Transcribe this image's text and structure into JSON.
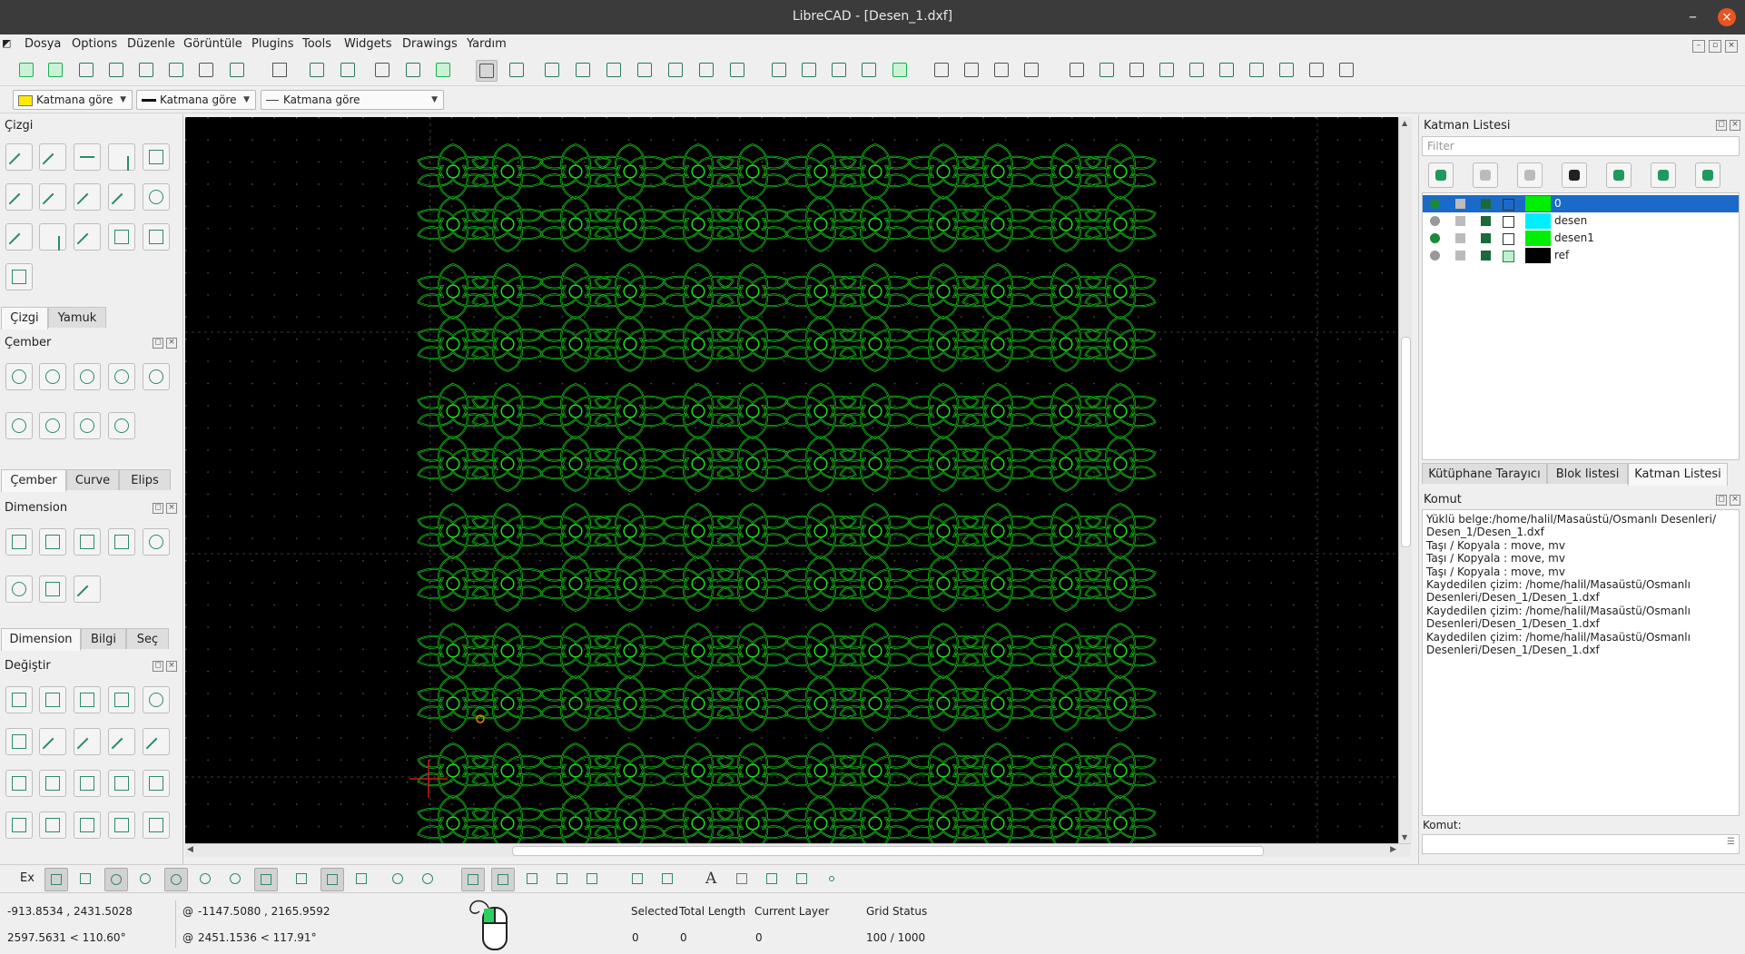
{
  "window": {
    "title": "LibreCAD - [Desen_1.dxf]"
  },
  "menu": [
    "Dosya",
    "Options",
    "Düzenle",
    "Görüntüle",
    "Plugins",
    "Tools",
    "Widgets",
    "Drawings",
    "Yardım"
  ],
  "properties": {
    "color": "Katmana göre",
    "width": "Katmana göre",
    "linetype": "Katmana göre",
    "color_swatch": "#ffea00"
  },
  "left": {
    "cizgi_title": "Çizgi",
    "cizgi_tabs": [
      "Çizgi",
      "Yamuk"
    ],
    "cember_title": "Çember",
    "cember_tabs": [
      "Çember",
      "Curve",
      "Elips"
    ],
    "dimension_title": "Dimension",
    "dimension_tabs": [
      "Dimension",
      "Bilgi",
      "Seç"
    ],
    "degistir_title": "Değiştir"
  },
  "layers": {
    "title": "Katman Listesi",
    "filter_placeholder": "Filter",
    "rows": [
      {
        "name": "0",
        "color": "#00ee00",
        "visible": true,
        "selected": true
      },
      {
        "name": "desen",
        "color": "#00eeff",
        "visible": false,
        "selected": false
      },
      {
        "name": "desen1",
        "color": "#00ee00",
        "visible": true,
        "selected": false
      },
      {
        "name": "ref",
        "color": "#000000",
        "visible": false,
        "selected": false
      }
    ],
    "tabs": [
      "Kütüphane Tarayıcı",
      "Blok listesi",
      "Katman Listesi"
    ]
  },
  "command": {
    "title": "Komut",
    "log": [
      "Yüklü belge:/home/halil/Masaüstü/Osmanlı Desenleri/\nDesen_1/Desen_1.dxf",
      "Taşı / Kopyala : move, mv",
      "Taşı / Kopyala : move, mv",
      "Taşı / Kopyala : move, mv",
      "Kaydedilen çizim: /home/halil/Masaüstü/Osmanlı\nDesenleri/Desen_1/Desen_1.dxf",
      "Kaydedilen çizim: /home/halil/Masaüstü/Osmanlı\nDesenleri/Desen_1/Desen_1.dxf",
      "Kaydedilen çizim: /home/halil/Masaüstü/Osmanlı\nDesenleri/Desen_1/Desen_1.dxf"
    ],
    "input_label": "Komut:"
  },
  "snap": {
    "ex_label": "Ex"
  },
  "status": {
    "abs_coord": "-913.8534 , 2431.5028",
    "abs_polar": "2597.5631 < 110.60°",
    "rel_coord": "-1147.5080 , 2165.9592",
    "rel_polar": "2451.1536 < 117.91°",
    "rel_prefix": "@",
    "selected_label": "Selected",
    "selected_value": "0",
    "total_length_label": "Total Length",
    "total_length_value": "0",
    "current_layer_label": "Current Layer",
    "current_layer_value": "0",
    "grid_status_label": "Grid Status",
    "grid_status_value": "100 / 1000"
  },
  "colors": {
    "pattern": "#1ee01e",
    "canvas": "#000000",
    "accent": "#1b6ac9"
  }
}
